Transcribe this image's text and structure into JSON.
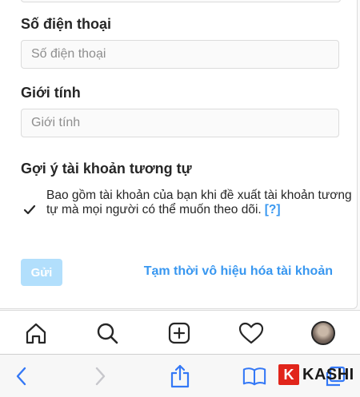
{
  "form": {
    "phone": {
      "label": "Số điện thoại",
      "placeholder": "Số điện thoại"
    },
    "gender": {
      "label": "Giới tính",
      "placeholder": "Giới tính"
    },
    "suggestions": {
      "heading": "Gợi ý tài khoản tương tự",
      "checked": true,
      "text": "Bao gồm tài khoản của bạn khi đề xuất tài khoản tương tự mà mọi người có thể muốn theo dõi.",
      "help_link": "[?]"
    },
    "submit_label": "Gửi",
    "disable_link": "Tạm thời vô hiệu hóa tài khoản"
  },
  "ig_nav": {
    "icons": [
      "home-icon",
      "search-icon",
      "new-post-icon",
      "heart-icon",
      "profile-avatar"
    ]
  },
  "safari": {
    "icons": [
      "back-arrow-icon",
      "forward-arrow-icon",
      "share-icon",
      "bookmarks-icon",
      "tabs-icon"
    ]
  },
  "watermark": {
    "badge": "K",
    "text": "KASHI",
    "accent": "#e1251b"
  },
  "colors": {
    "link": "#3897f0",
    "button_disabled": "#b2dffc",
    "text": "#262626",
    "border": "#dbdbdb"
  }
}
